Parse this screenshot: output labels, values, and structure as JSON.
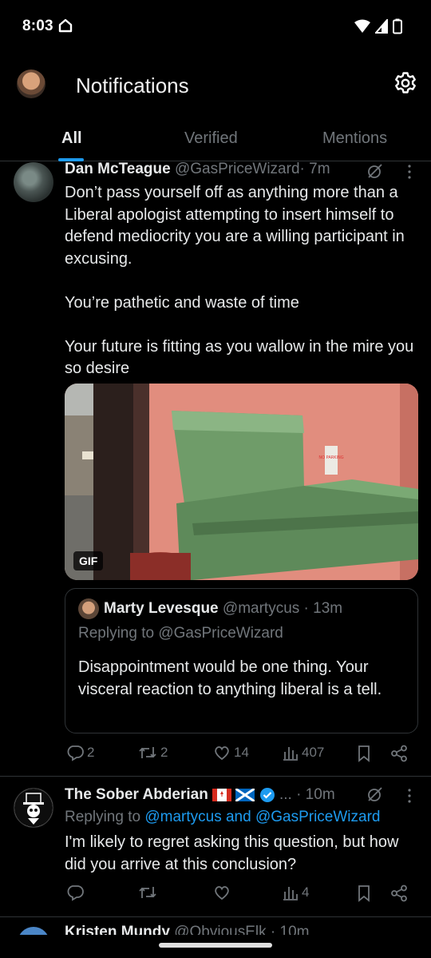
{
  "status_bar": {
    "time": "8:03"
  },
  "header": {
    "title": "Notifications"
  },
  "tabs": [
    {
      "label": "All",
      "active": true
    },
    {
      "label": "Verified",
      "active": false
    },
    {
      "label": "Mentions",
      "active": false
    }
  ],
  "tweets": [
    {
      "name": "Dan McTeague",
      "handle": "@GasPriceWizard",
      "time": "· 7m",
      "text": "Don’t pass yourself off as anything more than a Liberal apologist attempting to insert himself to defend mediocrity you are a willing participant in excusing.\n\nYou’re pathetic and waste of time\n\nYour future is fitting as you wallow in the mire you so desire",
      "media": {
        "badge": "GIF",
        "sign_text": "NO PARKING"
      },
      "quote": {
        "name": "Marty Levesque",
        "handle": "@martycus",
        "time": "· 13m",
        "replying": "Replying to @GasPriceWizard",
        "text": "Disappointment would be one thing. Your visceral reaction to anything liberal is a tell."
      },
      "stats": {
        "replies": "2",
        "reposts": "2",
        "likes": "14",
        "views": "407"
      }
    },
    {
      "name": "The Sober Abderian",
      "handle": "...",
      "time": "· 10m",
      "replying_prefix": "Replying to ",
      "replying_link": "@martycus and @GasPriceWizard",
      "text": "I'm likely to regret asking this question, but how did you arrive at this conclusion?",
      "stats": {
        "replies": "",
        "reposts": "",
        "likes": "",
        "views": "4"
      }
    },
    {
      "name": "Kristen Mundy",
      "handle": "@ObviousElk",
      "time": "· 10m"
    }
  ],
  "colors": {
    "accent": "#1d9bf0",
    "muted": "#71767b",
    "text": "#e7e9ea",
    "background": "#000000"
  }
}
